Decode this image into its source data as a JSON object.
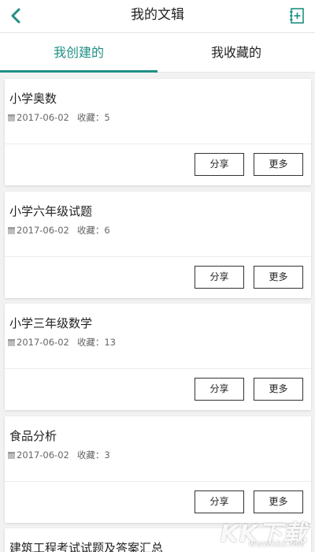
{
  "header": {
    "title": "我的文辑",
    "back_icon": "chevron-left-icon",
    "add_icon": "add-collection-icon"
  },
  "tabs": [
    {
      "label": "我创建的",
      "active": true
    },
    {
      "label": "我收藏的",
      "active": false
    }
  ],
  "accent_color": "#1f8f84",
  "cards": [
    {
      "title": "小学奥数",
      "date": "2017-06-02",
      "fav_label": "收藏：",
      "fav_count": "5",
      "share_label": "分享",
      "more_label": "更多"
    },
    {
      "title": "小学六年级试题",
      "date": "2017-06-02",
      "fav_label": "收藏：",
      "fav_count": "6",
      "share_label": "分享",
      "more_label": "更多"
    },
    {
      "title": "小学三年级数学",
      "date": "2017-06-02",
      "fav_label": "收藏：",
      "fav_count": "13",
      "share_label": "分享",
      "more_label": "更多"
    },
    {
      "title": "食品分析",
      "date": "2017-06-02",
      "fav_label": "收藏：",
      "fav_count": "3",
      "share_label": "分享",
      "more_label": "更多"
    },
    {
      "title": "建筑工程考试试题及答案汇总"
    }
  ],
  "watermark": {
    "logo": "KK下载",
    "site": "www.kkx.net"
  }
}
